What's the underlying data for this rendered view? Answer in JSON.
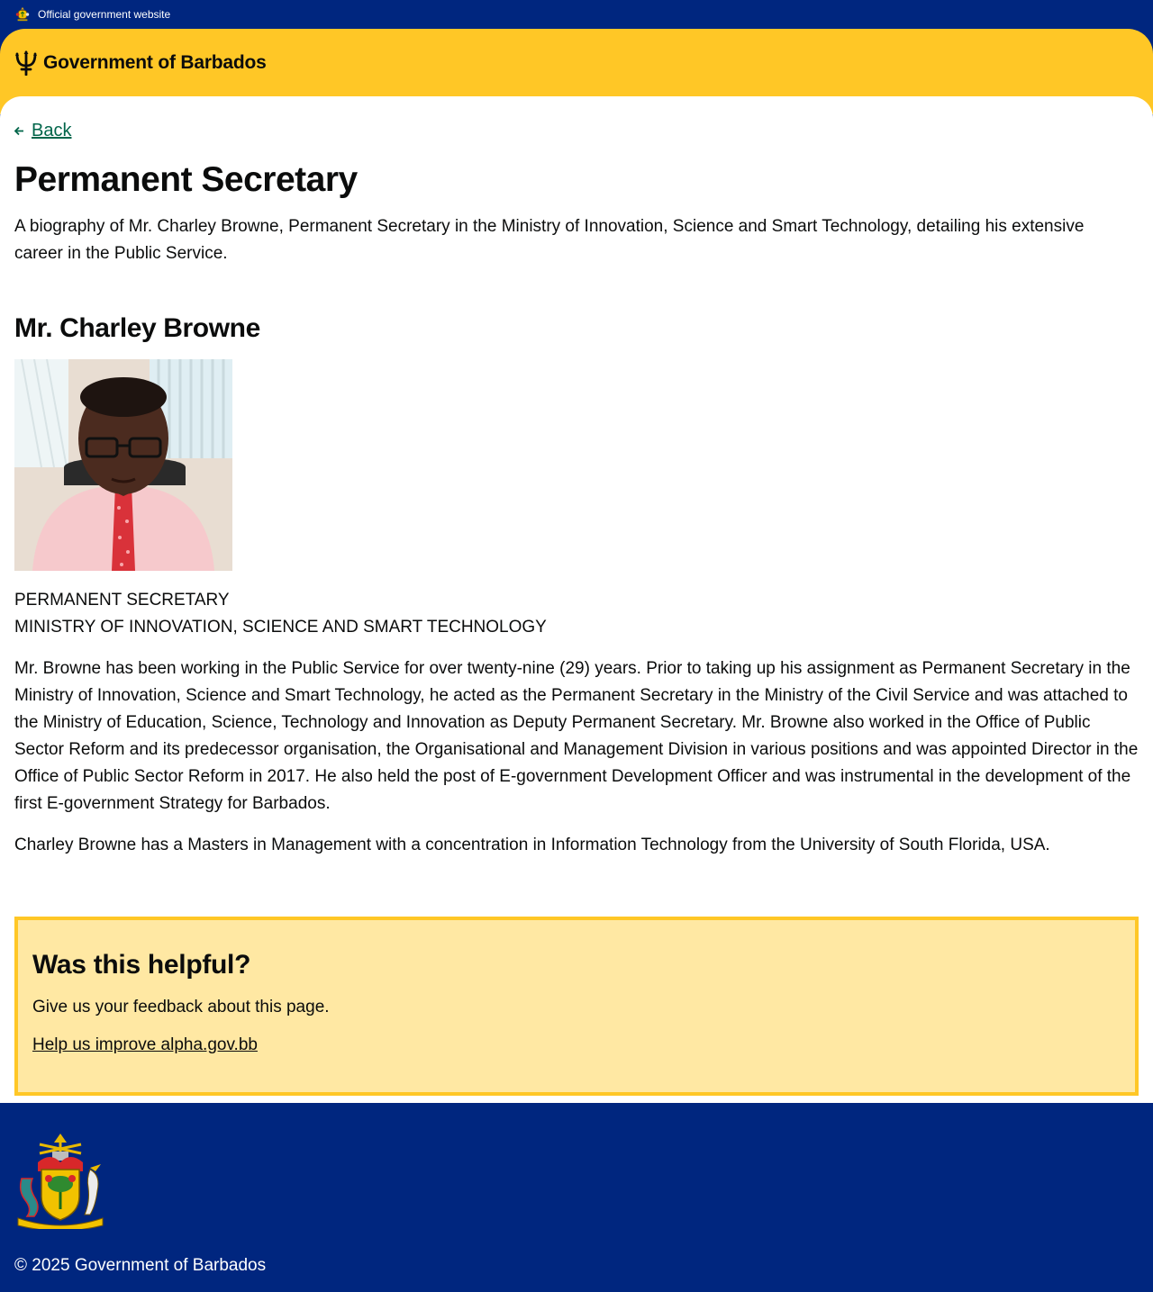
{
  "topbar": {
    "text": "Official government website",
    "crest_icon": "coat-of-arms-icon"
  },
  "header": {
    "brand_name": "Government of Barbados",
    "logo_icon": "trident-icon",
    "background": "#ffc726"
  },
  "nav": {
    "back_label": "Back"
  },
  "page": {
    "title": "Permanent Secretary",
    "lede": "A biography of Mr. Charley Browne, Permanent Secretary in the Ministry of Innovation, Science and Smart Technology, detailing his extensive career in the Public Service."
  },
  "profile": {
    "name": "Mr. Charley Browne",
    "role_line_1": "PERMANENT SECRETARY",
    "role_line_2": "MINISTRY OF INNOVATION, SCIENCE AND SMART TECHNOLOGY",
    "bio_paragraph_1": "Mr. Browne has been working in the Public Service for over twenty-nine (29) years. Prior to taking up his assignment as Permanent Secretary in the Ministry of Innovation, Science and Smart Technology, he acted as the Permanent Secretary in the Ministry of the Civil Service and was attached to the Ministry of Education, Science, Technology and Innovation as Deputy Permanent Secretary. Mr. Browne also worked in the Office of Public Sector Reform and its predecessor organisation, the Organisational and Management Division in various positions and was appointed Director in the Office of Public Sector Reform in 2017. He also held the post of E-government Development Officer and was instrumental in the development of the first E-government Strategy for Barbados.",
    "bio_paragraph_2": "Charley Browne has a Masters in Management with a concentration in Information Technology from the University of South Florida, USA."
  },
  "feedback": {
    "title": "Was this helpful?",
    "text": "Give us your feedback about this page.",
    "link_label": "Help us improve alpha.gov.bb",
    "background": "#ffe8a3",
    "border": "#ffc726"
  },
  "footer": {
    "copyright": "© 2025 Government of Barbados",
    "crest_icon": "coat-of-arms-icon",
    "background": "#00267f"
  },
  "colors": {
    "link": "#00654a",
    "navy": "#00267f",
    "gold": "#ffc726"
  }
}
